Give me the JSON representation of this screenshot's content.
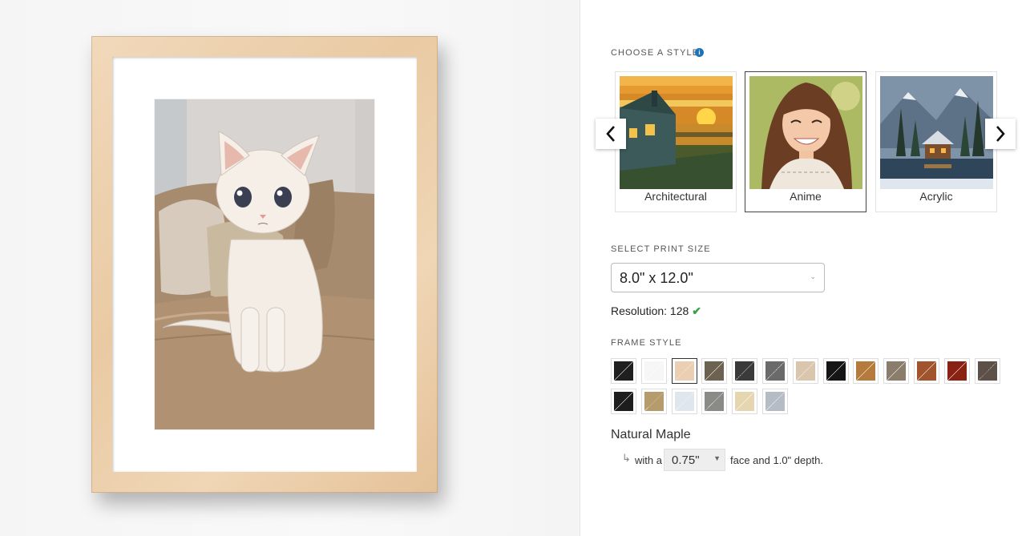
{
  "style_section": {
    "label": "CHOOSE A STYLE",
    "info_icon": "info-icon",
    "styles": [
      {
        "label": "Architectural",
        "selected": false
      },
      {
        "label": "Anime",
        "selected": true
      },
      {
        "label": "Acrylic",
        "selected": false
      }
    ],
    "prev_icon": "chevron-left-icon",
    "next_icon": "chevron-right-icon"
  },
  "print_size": {
    "label": "SELECT PRINT SIZE",
    "selected": "8.0\" x 12.0\""
  },
  "resolution": {
    "text": "Resolution: 128",
    "status_icon": "check-icon",
    "status_color": "#3aa149"
  },
  "frame_style": {
    "label": "FRAME STYLE",
    "selected_index": 2,
    "swatches": [
      {
        "name": "black",
        "color": "#1f1f1f"
      },
      {
        "name": "white",
        "color": "#f6f6f6"
      },
      {
        "name": "natural-maple",
        "color": "#ebcfb2"
      },
      {
        "name": "walnut",
        "color": "#6d6152"
      },
      {
        "name": "charcoal",
        "color": "#3a3a3a"
      },
      {
        "name": "gray-wood",
        "color": "#6a6a6a"
      },
      {
        "name": "light-oak",
        "color": "#d9c6ad"
      },
      {
        "name": "black-gold",
        "color": "#151515"
      },
      {
        "name": "golden-oak",
        "color": "#b47b3c"
      },
      {
        "name": "layered-wood",
        "color": "#8a7d6c"
      },
      {
        "name": "mahogany",
        "color": "#a0532d"
      },
      {
        "name": "cherry",
        "color": "#8a2214"
      },
      {
        "name": "espresso",
        "color": "#5c5049"
      },
      {
        "name": "black-grain",
        "color": "#1d1d1d"
      },
      {
        "name": "natural-oak",
        "color": "#b69b6c"
      },
      {
        "name": "white-wash",
        "color": "#dfe6ee"
      },
      {
        "name": "driftwood",
        "color": "#8a8a86"
      },
      {
        "name": "light-ash",
        "color": "#e6d6b0"
      },
      {
        "name": "silver",
        "color": "#b5bcc6"
      }
    ],
    "selected_name": "Natural Maple"
  },
  "depth": {
    "hook": "↳",
    "prefix": "with a",
    "face_value": "0.75\"",
    "suffix": "face and 1.0\" depth."
  }
}
